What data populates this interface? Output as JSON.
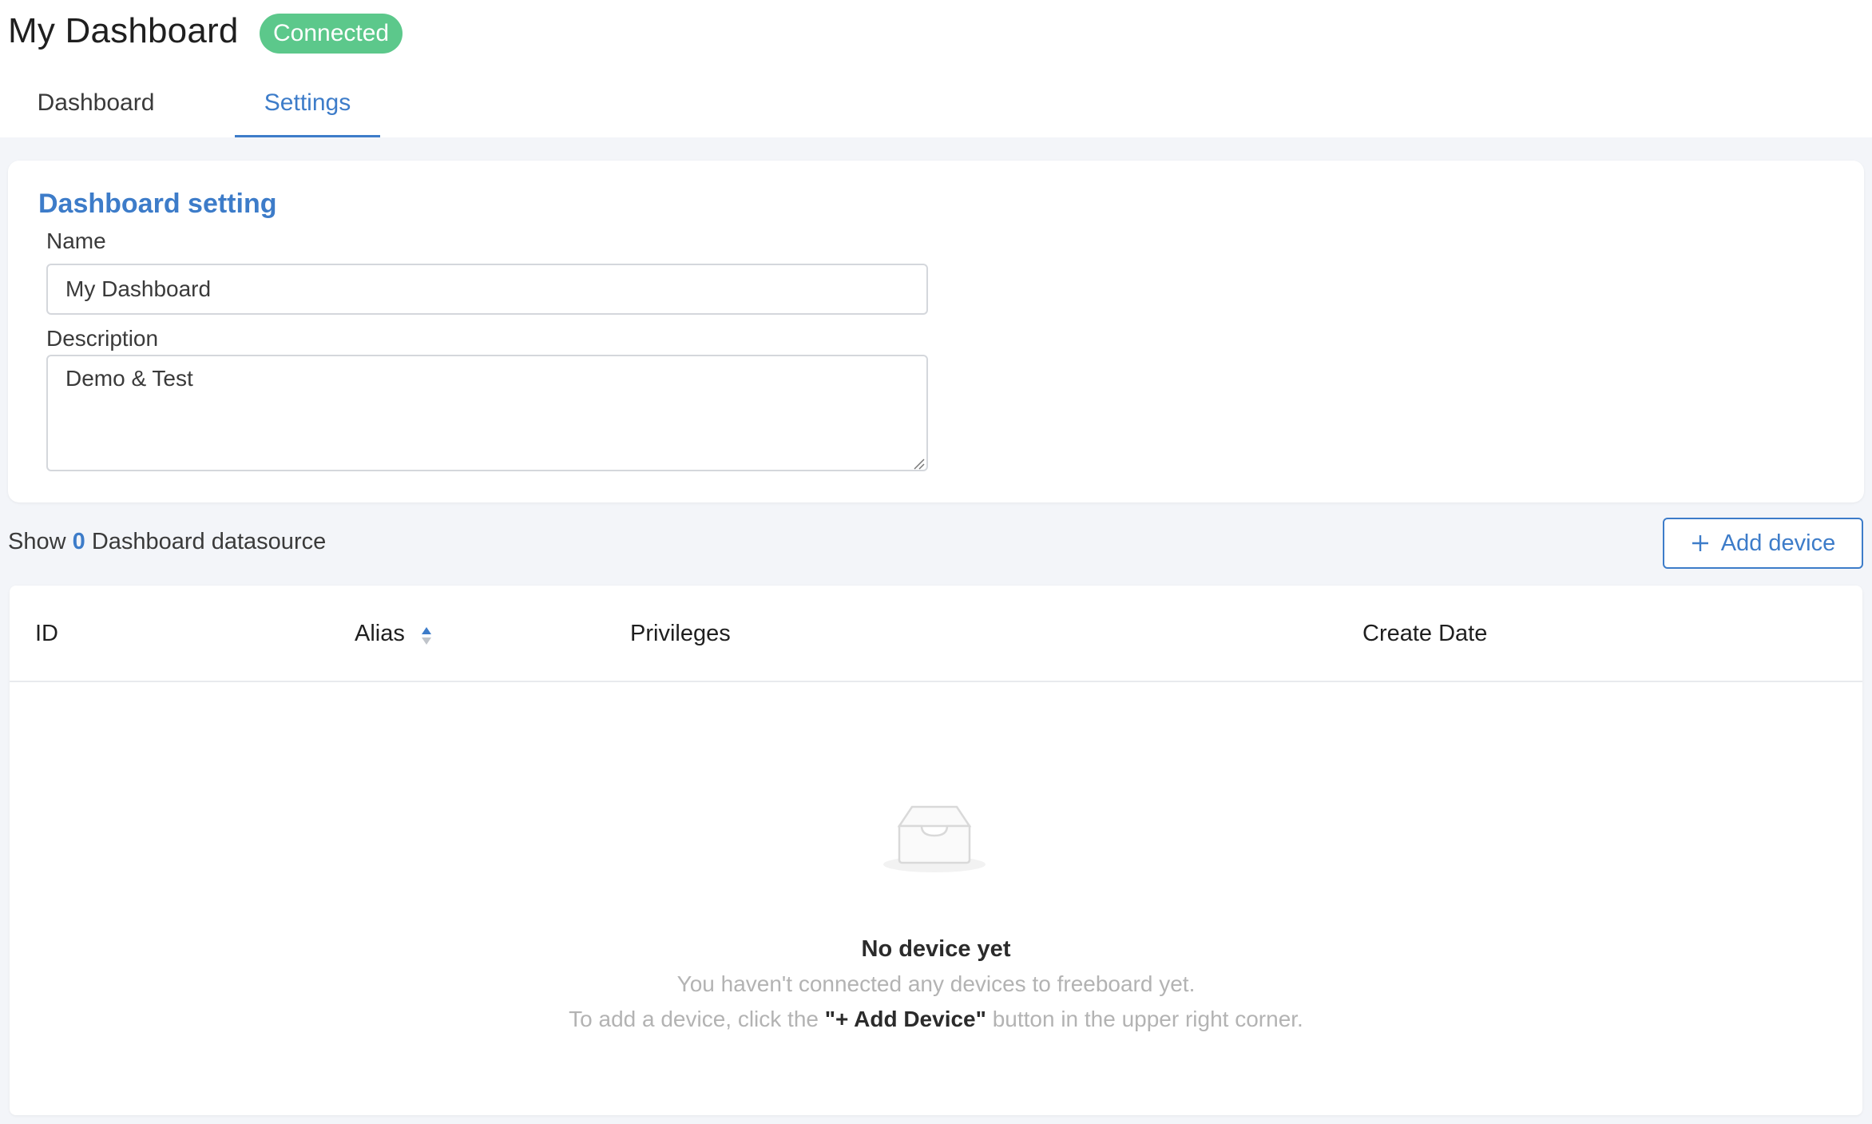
{
  "header": {
    "title": "My Dashboard",
    "status_badge": "Connected",
    "status_color": "#5cc88b"
  },
  "tabs": [
    {
      "label": "Dashboard",
      "active": false
    },
    {
      "label": "Settings",
      "active": true
    }
  ],
  "accent_color": "#3d7cc9",
  "settings": {
    "section_title": "Dashboard setting",
    "name_label": "Name",
    "name_value": "My Dashboard",
    "description_label": "Description",
    "description_value": "Demo & Test"
  },
  "datasource": {
    "show_prefix": "Show",
    "count": "0",
    "show_suffix": "Dashboard datasource",
    "add_button_label": "Add device",
    "add_button_icon": "plus-icon"
  },
  "table": {
    "columns": [
      "ID",
      "Alias",
      "Privileges",
      "Create Date"
    ],
    "sort_icon": "sort-icon",
    "rows": []
  },
  "empty_state": {
    "icon": "empty-inbox-icon",
    "title": "No device yet",
    "line1": "You haven't connected any devices to freeboard yet.",
    "line2_prefix": "To add a device, click the",
    "line2_bold": "\"+ Add Device\"",
    "line2_suffix": "button in the upper right corner."
  }
}
